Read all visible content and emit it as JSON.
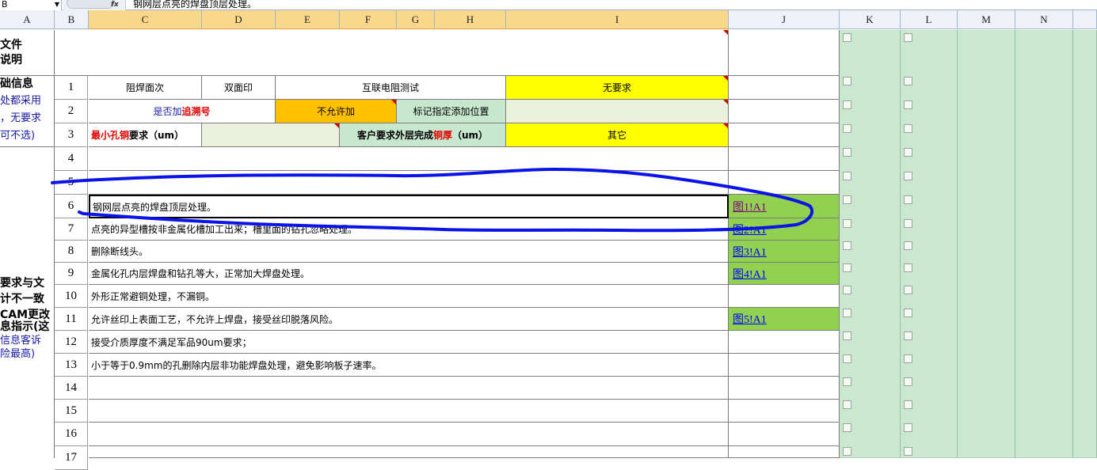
{
  "formula_bar": {
    "name_box": "B",
    "fx_label": "fx",
    "content": "钢网层点亮的焊盘顶层处理。"
  },
  "columns": [
    "A",
    "B",
    "C",
    "D",
    "E",
    "F",
    "G",
    "H",
    "I",
    "J",
    "K",
    "L",
    "M",
    "N"
  ],
  "left_column": {
    "lines": [
      {
        "text": "文件",
        "style": "bold"
      },
      {
        "text": "说明",
        "style": "bold"
      },
      {
        "text": "础信息",
        "style": "bold"
      },
      {
        "text": "处都采用",
        "style": "blue"
      },
      {
        "text": "，无要求",
        "style": "blue"
      },
      {
        "text": "可不选)",
        "style": "blue"
      },
      {
        "text": "要求与文",
        "style": "bold"
      },
      {
        "text": "计不一致",
        "style": "bold"
      },
      {
        "text": "CAM更改",
        "style": "bold"
      },
      {
        "text": "息指示(这",
        "style": "bold"
      },
      {
        "text": "信息客诉",
        "style": "blue"
      },
      {
        "text": "险最高)",
        "style": "blue"
      }
    ]
  },
  "rows": [
    "1",
    "2",
    "3",
    "4",
    "5",
    "6",
    "7",
    "8",
    "9",
    "10",
    "11",
    "12",
    "13",
    "14",
    "15",
    "16",
    "17"
  ],
  "basic_info": {
    "row1": {
      "c": "阻焊面次",
      "d": "双面印",
      "efgh": "互联电阻测试",
      "i": "无要求"
    },
    "row2": {
      "cd_prefix": "是否加",
      "cd_highlight": "追溯号",
      "e": "不允许加",
      "gh": "标记指定添加位置",
      "i": ""
    },
    "row3": {
      "c_highlight": "最小孔铜",
      "c_suffix": "要求（um）",
      "d": "",
      "fgh_prefix": "客户要求外层完成",
      "fgh_highlight": "铜厚",
      "fgh_suffix": "（um）",
      "i": "其它"
    }
  },
  "instructions": [
    {
      "row": "6",
      "text": "钢网层点亮的焊盘顶层处理。",
      "link": "图1!A1",
      "visited": true
    },
    {
      "row": "7",
      "text": "点亮的异型槽按非金属化槽加工出来；槽里面的钻孔忽略处理。",
      "link": "图2!A1",
      "visited": false
    },
    {
      "row": "8",
      "text": "删除断线头。",
      "link": "图3!A1",
      "visited": false
    },
    {
      "row": "9",
      "text": "金属化孔内层焊盘和钻孔等大，正常加大焊盘处理。",
      "link": "图4!A1",
      "visited": false
    },
    {
      "row": "10",
      "text": "外形正常避铜处理，不漏铜。",
      "link": "",
      "visited": false
    },
    {
      "row": "11",
      "text": "允许丝印上表面工艺，不允许上焊盘，接受丝印脱落风险。",
      "link": "图5!A1",
      "visited": false
    },
    {
      "row": "12",
      "text": "接受介质厚度不满足军品90um要求；",
      "link": "",
      "visited": false
    },
    {
      "row": "13",
      "text": "小于等于0.9mm的孔删除内层非功能焊盘处理，避免影响板子速率。",
      "link": "",
      "visited": false
    }
  ],
  "colors": {
    "yellow": "#ffff00",
    "orange": "#ffc000",
    "link_green": "#92d050",
    "sheet_green": "#c9e8cf",
    "annotation_blue": "#0a14e6"
  }
}
